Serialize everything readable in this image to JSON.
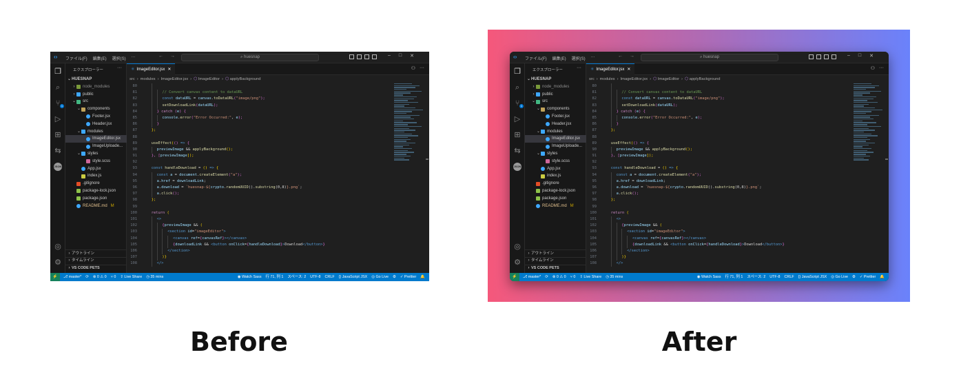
{
  "captions": {
    "before": "Before",
    "after": "After"
  },
  "colors": {
    "gradient_start": "#f5587b",
    "gradient_mid": "#b06ab3",
    "gradient_end": "#6a82fb",
    "statusbar": "#007acc",
    "editor_bg": "#1f1f1f"
  },
  "titlebar": {
    "menu": [
      "ファイル(F)",
      "編集(E)",
      "選択(S)",
      "···"
    ],
    "search_placeholder": "huesnap",
    "icons": [
      "vscode-logo-icon",
      "arrow-left-icon",
      "arrow-right-icon",
      "layout-icon",
      "minimize-icon",
      "maximize-icon",
      "close-icon"
    ]
  },
  "sidebar": {
    "title": "エクスプローラー",
    "more": "···",
    "tree": [
      {
        "label": "HUESNAP",
        "depth": 0,
        "chevron": "⌄",
        "bold": true,
        "icon": "",
        "color": ""
      },
      {
        "label": "node_modules",
        "depth": 1,
        "chevron": "›",
        "icon": "folder",
        "color": "#7a9a3a",
        "dim": true
      },
      {
        "label": "public",
        "depth": 1,
        "chevron": "›",
        "icon": "folder",
        "color": "#3ea8ff"
      },
      {
        "label": "src",
        "depth": 1,
        "chevron": "⌄",
        "icon": "folder",
        "color": "#42b883"
      },
      {
        "label": "components",
        "depth": 2,
        "chevron": "⌄",
        "icon": "folder",
        "color": "#c0a35a"
      },
      {
        "label": "Footer.jsx",
        "depth": 3,
        "chevron": "",
        "icon": "react",
        "color": "#3ea8ff"
      },
      {
        "label": "Header.jsx",
        "depth": 3,
        "chevron": "",
        "icon": "react",
        "color": "#3ea8ff"
      },
      {
        "label": "modules",
        "depth": 2,
        "chevron": "⌄",
        "icon": "folder",
        "color": "#3ea8ff"
      },
      {
        "label": "ImageEditor.jsx",
        "depth": 3,
        "chevron": "",
        "icon": "react",
        "color": "#3ea8ff",
        "selected": true
      },
      {
        "label": "ImageUploade...",
        "depth": 3,
        "chevron": "",
        "icon": "react",
        "color": "#3ea8ff"
      },
      {
        "label": "styles",
        "depth": 2,
        "chevron": "⌄",
        "icon": "folder",
        "color": "#3ea8ff"
      },
      {
        "label": "style.scss",
        "depth": 3,
        "chevron": "",
        "icon": "sass",
        "color": "#cd6799"
      },
      {
        "label": "App.jsx",
        "depth": 2,
        "chevron": "",
        "icon": "react",
        "color": "#3ea8ff"
      },
      {
        "label": "index.js",
        "depth": 2,
        "chevron": "",
        "icon": "js",
        "color": "#cbcb41"
      },
      {
        "label": ".gitignore",
        "depth": 1,
        "chevron": "",
        "icon": "git",
        "color": "#e44d26"
      },
      {
        "label": "package-lock.json",
        "depth": 1,
        "chevron": "",
        "icon": "npm",
        "color": "#8dc149"
      },
      {
        "label": "package.json",
        "depth": 1,
        "chevron": "",
        "icon": "npm",
        "color": "#8dc149"
      },
      {
        "label": "README.md",
        "depth": 1,
        "chevron": "",
        "icon": "info",
        "color": "#3ea8ff",
        "status": "M"
      }
    ],
    "bottom": [
      {
        "label": "アウトライン",
        "chevron": "›"
      },
      {
        "label": "タイムライン",
        "chevron": "›"
      },
      {
        "label": "VS CODE PETS",
        "chevron": "›",
        "bold": true
      }
    ]
  },
  "editor": {
    "tab": {
      "label": "ImageEditor.jsx",
      "close": "✕"
    },
    "breadcrumb": [
      {
        "text": "src",
        "sym": false
      },
      {
        "text": "modules",
        "sym": false
      },
      {
        "text": "ImageEditor.jsx",
        "sym": false
      },
      {
        "text": "ImageEditor",
        "sym": true
      },
      {
        "text": "applyBackground",
        "sym": true
      }
    ],
    "breadcrumb_sep": "›",
    "lines": [
      {
        "n": "80",
        "indent": 2,
        "segs": []
      },
      {
        "n": "81",
        "indent": 3,
        "segs": [
          {
            "t": "// Convert canvas content to dataURL",
            "c": "t-cmt"
          }
        ]
      },
      {
        "n": "82",
        "indent": 3,
        "segs": [
          {
            "t": "const ",
            "c": "t-key"
          },
          {
            "t": "dataURL",
            "c": "t-var"
          },
          {
            "t": " = ",
            "c": "txt"
          },
          {
            "t": "canvas",
            "c": "t-var"
          },
          {
            "t": ".",
            "c": "txt"
          },
          {
            "t": "toDataURL",
            "c": "t-fn"
          },
          {
            "t": "(",
            "c": "t-br2"
          },
          {
            "t": "\"image/png\"",
            "c": "t-str"
          },
          {
            "t": ");",
            "c": "t-br2"
          }
        ]
      },
      {
        "n": "83",
        "indent": 3,
        "segs": [
          {
            "t": "setDownloadLink",
            "c": "t-fn"
          },
          {
            "t": "(",
            "c": "t-br2"
          },
          {
            "t": "dataURL",
            "c": "t-var"
          },
          {
            "t": ");",
            "c": "t-br2"
          }
        ]
      },
      {
        "n": "84",
        "indent": 2,
        "segs": [
          {
            "t": "} ",
            "c": "t-br2"
          },
          {
            "t": "catch ",
            "c": "t-ctl"
          },
          {
            "t": "(",
            "c": "t-br2"
          },
          {
            "t": "e",
            "c": "t-var"
          },
          {
            "t": ") {",
            "c": "t-br2"
          }
        ]
      },
      {
        "n": "85",
        "indent": 3,
        "segs": [
          {
            "t": "console",
            "c": "t-var"
          },
          {
            "t": ".",
            "c": "txt"
          },
          {
            "t": "error",
            "c": "t-fn"
          },
          {
            "t": "(",
            "c": "t-br2"
          },
          {
            "t": "\"Error Occurred:\"",
            "c": "t-str"
          },
          {
            "t": ", ",
            "c": "txt"
          },
          {
            "t": "e",
            "c": "t-var"
          },
          {
            "t": ");",
            "c": "t-br2"
          }
        ]
      },
      {
        "n": "86",
        "indent": 2,
        "segs": [
          {
            "t": "}",
            "c": "t-br2"
          }
        ]
      },
      {
        "n": "87",
        "indent": 1,
        "segs": [
          {
            "t": "};",
            "c": "t-br"
          }
        ]
      },
      {
        "n": "88",
        "indent": 1,
        "segs": []
      },
      {
        "n": "89",
        "indent": 1,
        "segs": [
          {
            "t": "useEffect",
            "c": "t-fn"
          },
          {
            "t": "(",
            "c": "t-br"
          },
          {
            "t": "() ",
            "c": "t-br2"
          },
          {
            "t": "=> ",
            "c": "t-key"
          },
          {
            "t": "{",
            "c": "t-br2"
          }
        ]
      },
      {
        "n": "90",
        "indent": 2,
        "segs": [
          {
            "t": "previewImage",
            "c": "t-var"
          },
          {
            "t": " && ",
            "c": "txt"
          },
          {
            "t": "applyBackground",
            "c": "t-fn"
          },
          {
            "t": "();",
            "c": "t-br"
          }
        ]
      },
      {
        "n": "91",
        "indent": 1,
        "segs": [
          {
            "t": "}, ",
            "c": "t-br2"
          },
          {
            "t": "[",
            "c": "t-br2"
          },
          {
            "t": "previewImage",
            "c": "t-var"
          },
          {
            "t": "]);",
            "c": "t-br"
          }
        ]
      },
      {
        "n": "92",
        "indent": 1,
        "segs": []
      },
      {
        "n": "93",
        "indent": 1,
        "segs": [
          {
            "t": "const ",
            "c": "t-key"
          },
          {
            "t": "handleDownload",
            "c": "t-fn"
          },
          {
            "t": " = ",
            "c": "txt"
          },
          {
            "t": "() ",
            "c": "t-br"
          },
          {
            "t": "=> ",
            "c": "t-key"
          },
          {
            "t": "{",
            "c": "t-br"
          }
        ]
      },
      {
        "n": "94",
        "indent": 2,
        "segs": [
          {
            "t": "const ",
            "c": "t-key"
          },
          {
            "t": "a",
            "c": "t-var"
          },
          {
            "t": " = ",
            "c": "txt"
          },
          {
            "t": "document",
            "c": "t-var"
          },
          {
            "t": ".",
            "c": "txt"
          },
          {
            "t": "createElement",
            "c": "t-fn"
          },
          {
            "t": "(",
            "c": "t-br2"
          },
          {
            "t": "\"a\"",
            "c": "t-str"
          },
          {
            "t": ");",
            "c": "t-br2"
          }
        ]
      },
      {
        "n": "95",
        "indent": 2,
        "segs": [
          {
            "t": "a",
            "c": "t-var"
          },
          {
            "t": ".",
            "c": "txt"
          },
          {
            "t": "href",
            "c": "t-var"
          },
          {
            "t": " = ",
            "c": "txt"
          },
          {
            "t": "downloadLink",
            "c": "t-var"
          },
          {
            "t": ";",
            "c": "txt"
          }
        ]
      },
      {
        "n": "96",
        "indent": 2,
        "segs": [
          {
            "t": "a",
            "c": "t-var"
          },
          {
            "t": ".",
            "c": "txt"
          },
          {
            "t": "download",
            "c": "t-var"
          },
          {
            "t": " = ",
            "c": "txt"
          },
          {
            "t": "`huesnap-${",
            "c": "t-str"
          },
          {
            "t": "crypto",
            "c": "t-var"
          },
          {
            "t": ".",
            "c": "txt"
          },
          {
            "t": "randomUUID",
            "c": "t-fn"
          },
          {
            "t": "().",
            "c": "txt"
          },
          {
            "t": "substring",
            "c": "t-fn"
          },
          {
            "t": "(0,8)",
            "c": "txt"
          },
          {
            "t": "}.png`",
            "c": "t-str"
          },
          {
            "t": ";",
            "c": "txt"
          }
        ]
      },
      {
        "n": "97",
        "indent": 2,
        "segs": [
          {
            "t": "a",
            "c": "t-var"
          },
          {
            "t": ".",
            "c": "txt"
          },
          {
            "t": "click",
            "c": "t-fn"
          },
          {
            "t": "();",
            "c": "t-br2"
          }
        ]
      },
      {
        "n": "98",
        "indent": 1,
        "segs": [
          {
            "t": "};",
            "c": "t-br"
          }
        ]
      },
      {
        "n": "99",
        "indent": 1,
        "segs": []
      },
      {
        "n": "100",
        "indent": 1,
        "segs": [
          {
            "t": "return ",
            "c": "t-ctl"
          },
          {
            "t": "(",
            "c": "t-br"
          }
        ]
      },
      {
        "n": "101",
        "indent": 2,
        "segs": [
          {
            "t": "<>",
            "c": "t-tag"
          }
        ]
      },
      {
        "n": "102",
        "indent": 3,
        "segs": [
          {
            "t": "{",
            "c": "t-br2"
          },
          {
            "t": "previewImage",
            "c": "t-var"
          },
          {
            "t": " && ",
            "c": "txt"
          },
          {
            "t": "(",
            "c": "t-br"
          }
        ]
      },
      {
        "n": "103",
        "indent": 4,
        "segs": [
          {
            "t": "<section ",
            "c": "t-tag"
          },
          {
            "t": "id",
            "c": "t-attr"
          },
          {
            "t": "=",
            "c": "txt"
          },
          {
            "t": "\"imageEditor\"",
            "c": "t-str"
          },
          {
            "t": ">",
            "c": "t-tag"
          }
        ]
      },
      {
        "n": "104",
        "indent": 5,
        "segs": [
          {
            "t": "<canvas ",
            "c": "t-tag"
          },
          {
            "t": "ref",
            "c": "t-attr"
          },
          {
            "t": "=",
            "c": "txt"
          },
          {
            "t": "{",
            "c": "t-br2"
          },
          {
            "t": "canvasRef",
            "c": "t-var"
          },
          {
            "t": "}",
            "c": "t-br2"
          },
          {
            "t": "></canvas>",
            "c": "t-tag"
          }
        ]
      },
      {
        "n": "105",
        "indent": 5,
        "segs": [
          {
            "t": "{",
            "c": "t-br2"
          },
          {
            "t": "downloadLink",
            "c": "t-var"
          },
          {
            "t": " && ",
            "c": "txt"
          },
          {
            "t": "<button ",
            "c": "t-tag"
          },
          {
            "t": "onClick",
            "c": "t-attr"
          },
          {
            "t": "=",
            "c": "txt"
          },
          {
            "t": "{",
            "c": "t-br2"
          },
          {
            "t": "handleDownload",
            "c": "t-var"
          },
          {
            "t": "}",
            "c": "t-br2"
          },
          {
            "t": ">",
            "c": "t-tag"
          },
          {
            "t": "Download",
            "c": "txt"
          },
          {
            "t": "</button>",
            "c": "t-tag"
          },
          {
            "t": "}",
            "c": "t-br2"
          }
        ]
      },
      {
        "n": "106",
        "indent": 4,
        "segs": [
          {
            "t": "</section>",
            "c": "t-tag"
          }
        ]
      },
      {
        "n": "107",
        "indent": 3,
        "segs": [
          {
            "t": ")}",
            "c": "t-br"
          }
        ]
      },
      {
        "n": "108",
        "indent": 2,
        "segs": [
          {
            "t": "</>",
            "c": "t-tag"
          }
        ]
      }
    ]
  },
  "statusbar": {
    "remote": "⚡",
    "left": [
      "⎇ master*",
      "⟳",
      "⊗ 0 ⚠ 0",
      "⑂ 0",
      "⇪ Live Share",
      "◷ 35 mins"
    ],
    "right": [
      "◉ Watch Sass",
      "行 71, 列 1",
      "スペース: 2",
      "UTF-8",
      "CRLF",
      "{} JavaScript JSX",
      "◎ Go Live",
      "⚙",
      "✓ Prettier",
      "🔔"
    ]
  }
}
